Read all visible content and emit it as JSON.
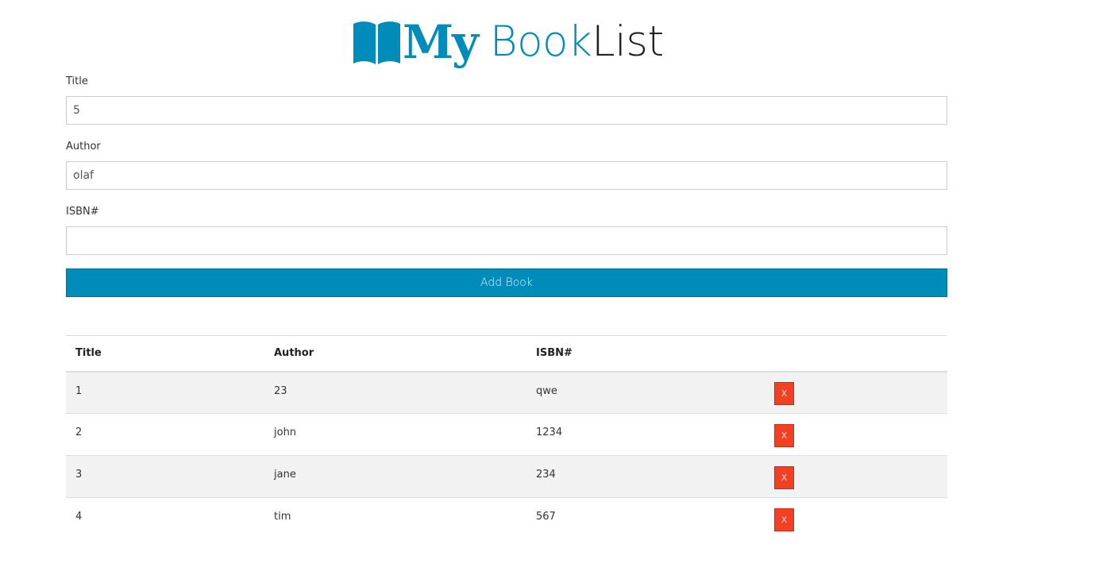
{
  "brand": {
    "my": "My",
    "book": "Book",
    "list": "List",
    "accent_color": "#008cba",
    "dark_color": "#222222",
    "icon": "open-book-icon"
  },
  "form": {
    "title_label": "Title",
    "title_value": "5",
    "author_label": "Author",
    "author_value": "olaf",
    "isbn_label": "ISBN#",
    "isbn_value": "",
    "submit_label": "Add Book",
    "submit_color": "#008cba"
  },
  "table": {
    "headers": {
      "title": "Title",
      "author": "Author",
      "isbn": "ISBN#"
    },
    "delete_label": "X",
    "delete_color": "#f04124",
    "rows": [
      {
        "title": "1",
        "author": "23",
        "isbn": "qwe"
      },
      {
        "title": "2",
        "author": "john",
        "isbn": "1234"
      },
      {
        "title": "3",
        "author": "jane",
        "isbn": "234"
      },
      {
        "title": "4",
        "author": "tim",
        "isbn": "567"
      }
    ]
  }
}
